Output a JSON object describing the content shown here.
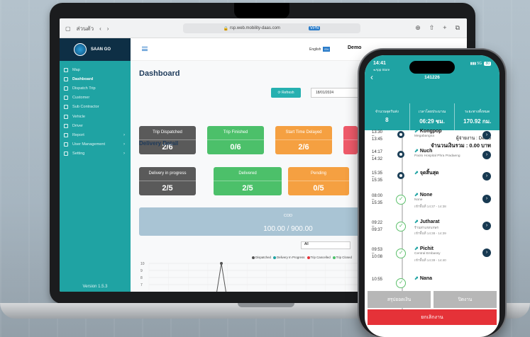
{
  "browser": {
    "sidebar_label": "ส่วนตัว",
    "url": "rsp.web.mobility-daas.com",
    "vpn": "VPN"
  },
  "app": {
    "logo": "SAAN GO",
    "language": "English",
    "language_badge": "EN",
    "user": "Demo",
    "version": "Version 1.5.3"
  },
  "sidebar": {
    "items": [
      {
        "label": "Map",
        "active": false,
        "chev": ""
      },
      {
        "label": "Dashboard",
        "active": true,
        "chev": ""
      },
      {
        "label": "Dispatch Trip",
        "active": false,
        "chev": ""
      },
      {
        "label": "Customer",
        "active": false,
        "chev": ""
      },
      {
        "label": "Sub Contractor",
        "active": false,
        "chev": ""
      },
      {
        "label": "Vehicle",
        "active": false,
        "chev": ""
      },
      {
        "label": "Driver",
        "active": false,
        "chev": ""
      },
      {
        "label": "Report",
        "active": false,
        "chev": "›"
      },
      {
        "label": "User Management",
        "active": false,
        "chev": "›"
      },
      {
        "label": "Setting",
        "active": false,
        "chev": "›"
      }
    ]
  },
  "dashboard": {
    "title": "Dashboard",
    "refresh": "Refresh",
    "date": "18/01/2024",
    "cards": [
      {
        "label": "Trip Dispatched",
        "value": "2/6",
        "color": "#5a5a5a"
      },
      {
        "label": "Trip Finished",
        "value": "0/6",
        "color": "#4cc06a"
      },
      {
        "label": "Start Time Delayed",
        "value": "2/6",
        "color": "#f5a041"
      },
      {
        "label": "",
        "value": "",
        "color": "#ef5a6a"
      }
    ],
    "delivery_title": "Delivery Detail",
    "delivery_cards": [
      {
        "label": "Delivery in progress",
        "value": "2/5",
        "color": "#5a5a5a"
      },
      {
        "label": "Delivered",
        "value": "2/5",
        "color": "#4cc06a"
      },
      {
        "label": "Pending",
        "value": "0/5",
        "color": "#f5a041"
      }
    ],
    "cod_label": "COD",
    "cod_value": "100.00 / 900.00",
    "filter": "All",
    "legend": [
      {
        "label": "Dispatched",
        "color": "#555555"
      },
      {
        "label": "Delivery In Progress",
        "color": "#1fa3a3"
      },
      {
        "label": "Trip Cancelled",
        "color": "#e53238"
      },
      {
        "label": "Trip Closed",
        "color": "#4cc06a"
      }
    ]
  },
  "chart_data": {
    "type": "line",
    "title": "",
    "xlabel": "",
    "ylabel": "",
    "ylim": [
      6,
      10
    ],
    "y_ticks": [
      "10",
      "9",
      "8",
      "7"
    ],
    "series": [
      {
        "name": "Dispatched",
        "x": [
          0,
          1,
          2
        ],
        "values": [
          0,
          10,
          0
        ]
      }
    ]
  },
  "phone": {
    "time": "14:41",
    "store": "◂ App Store",
    "signal": "5G",
    "battery": "80",
    "title": "141226",
    "stats": [
      {
        "label": "จำนวนจุดรับส่ง",
        "value": "8"
      },
      {
        "label": "เวลาโดยประมาณ",
        "value": "06:29 ชม."
      },
      {
        "label": "ระยะทางทั้งหมด",
        "value": "170.92 กม."
      }
    ],
    "assignee": "ผู้จ่ายงาน : Demo",
    "total": "จำนวนเงินรวม : 0.00 บาท",
    "stops": [
      {
        "t1": "13:30",
        "t2": "13:45",
        "name": "Kongpop",
        "sub": "Megabangna",
        "sub2": "",
        "node": "ring"
      },
      {
        "t1": "14:17",
        "t2": "14:32",
        "name": "Nuch",
        "sub": "Paolo Hospital Phra Pradaeng",
        "sub2": "",
        "node": "ring"
      },
      {
        "t1": "15:35",
        "t2": "15:35",
        "name": "จุดสิ้นสุด",
        "sub": "",
        "sub2": "",
        "node": "ring"
      },
      {
        "t1": "08:00",
        "t2": "15:35",
        "name": "None",
        "sub": "None",
        "sub2": "เข้าพื้นที่ 14:37 - 14:38",
        "node": "done"
      },
      {
        "t1": "09:22",
        "t2": "09:37",
        "name": "Jutharat",
        "sub": "ร้านท่าแขกเกษร",
        "sub2": "เข้าพื้นที่ 14:38 - 14:39",
        "node": "done"
      },
      {
        "t1": "09:53",
        "t2": "10:08",
        "name": "Pichit",
        "sub": "Central Embassy",
        "sub2": "เข้าพื้นที่ 14:39 - 14:40",
        "node": "done"
      },
      {
        "t1": "10:55",
        "t2": "",
        "name": "Nana",
        "sub": "",
        "sub2": "",
        "node": "done"
      }
    ],
    "btn_summary": "สรุปยอดเงิน",
    "btn_close": "ปิดงาน",
    "btn_cancel": "ยกเลิกงาน"
  }
}
